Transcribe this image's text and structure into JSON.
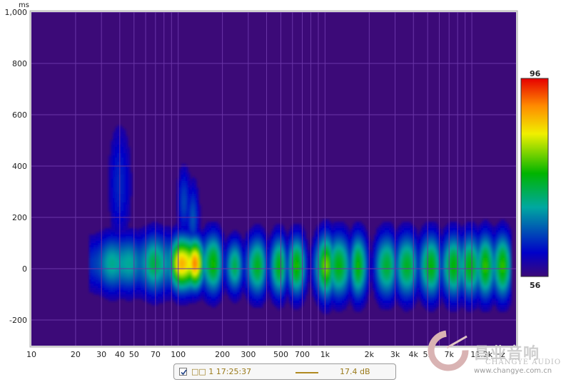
{
  "chart_data": {
    "type": "heatmap",
    "subtype": "spectrogram",
    "title": "",
    "xlabel": "Hz",
    "ylabel": "ms",
    "x_scale": "log",
    "xlim": [
      10,
      20000
    ],
    "ylim": [
      -300,
      1000
    ],
    "x_ticks": [
      {
        "value": 10,
        "label": "10"
      },
      {
        "value": 20,
        "label": "20"
      },
      {
        "value": 30,
        "label": "30"
      },
      {
        "value": 40,
        "label": "40"
      },
      {
        "value": 50,
        "label": "50"
      },
      {
        "value": 70,
        "label": "70"
      },
      {
        "value": 100,
        "label": "100"
      },
      {
        "value": 200,
        "label": "200"
      },
      {
        "value": 300,
        "label": "300"
      },
      {
        "value": 500,
        "label": "500"
      },
      {
        "value": 700,
        "label": "700"
      },
      {
        "value": 1000,
        "label": "1k"
      },
      {
        "value": 2000,
        "label": "2k"
      },
      {
        "value": 3000,
        "label": "3k"
      },
      {
        "value": 4000,
        "label": "4k"
      },
      {
        "value": 5000,
        "label": "5k"
      },
      {
        "value": 7000,
        "label": "7k"
      },
      {
        "value": 11200,
        "label": "11.2k Hz"
      }
    ],
    "y_ticks": [
      {
        "value": 1000,
        "label": "1,000"
      },
      {
        "value": 800,
        "label": "800"
      },
      {
        "value": 600,
        "label": "600"
      },
      {
        "value": 400,
        "label": "400"
      },
      {
        "value": 200,
        "label": "200"
      },
      {
        "value": 0,
        "label": "0"
      },
      {
        "value": -200,
        "label": "-200"
      }
    ],
    "colorbar": {
      "min": 56,
      "max": 96,
      "min_label": "56",
      "max_label": "96"
    },
    "grid": true,
    "series": [
      {
        "name": "□□ 1 17:25:37",
        "value_label": "17.4 dB",
        "color": "#b08a20"
      }
    ],
    "blobs": [
      {
        "f": 40,
        "t": 20,
        "level": 72,
        "bw": 0.16,
        "spread": 75
      },
      {
        "f": 40,
        "t": 330,
        "level": 64,
        "bw": 0.05,
        "spread": 160
      },
      {
        "f": 70,
        "t": 20,
        "level": 74,
        "bw": 0.12,
        "spread": 80
      },
      {
        "f": 110,
        "t": 20,
        "level": 93,
        "bw": 0.07,
        "spread": 70
      },
      {
        "f": 128,
        "t": 20,
        "level": 92,
        "bw": 0.05,
        "spread": 65
      },
      {
        "f": 110,
        "t": 260,
        "level": 66,
        "bw": 0.03,
        "spread": 95
      },
      {
        "f": 125,
        "t": 200,
        "level": 66,
        "bw": 0.03,
        "spread": 95
      },
      {
        "f": 170,
        "t": 20,
        "level": 80,
        "bw": 0.05,
        "spread": 80
      },
      {
        "f": 240,
        "t": 10,
        "level": 76,
        "bw": 0.04,
        "spread": 70
      },
      {
        "f": 340,
        "t": 10,
        "level": 78,
        "bw": 0.05,
        "spread": 80
      },
      {
        "f": 480,
        "t": 10,
        "level": 79,
        "bw": 0.04,
        "spread": 80
      },
      {
        "f": 640,
        "t": 10,
        "level": 82,
        "bw": 0.04,
        "spread": 80
      },
      {
        "f": 1000,
        "t": 10,
        "level": 82,
        "bw": 0.05,
        "spread": 85
      },
      {
        "f": 1250,
        "t": 10,
        "level": 80,
        "bw": 0.05,
        "spread": 85
      },
      {
        "f": 1700,
        "t": 10,
        "level": 80,
        "bw": 0.04,
        "spread": 85
      },
      {
        "f": 2600,
        "t": 10,
        "level": 78,
        "bw": 0.05,
        "spread": 85
      },
      {
        "f": 3600,
        "t": 10,
        "level": 79,
        "bw": 0.05,
        "spread": 85
      },
      {
        "f": 5200,
        "t": 10,
        "level": 80,
        "bw": 0.05,
        "spread": 85
      },
      {
        "f": 7400,
        "t": 10,
        "level": 80,
        "bw": 0.05,
        "spread": 85
      },
      {
        "f": 9800,
        "t": 10,
        "level": 80,
        "bw": 0.05,
        "spread": 85
      },
      {
        "f": 12500,
        "t": 10,
        "level": 79,
        "bw": 0.05,
        "spread": 85
      },
      {
        "f": 16000,
        "t": 10,
        "level": 79,
        "bw": 0.05,
        "spread": 85
      }
    ]
  },
  "legend": {
    "checked": true,
    "name": "□□ 1 17:25:37",
    "value": "17.4 dB"
  },
  "watermark": {
    "brand": "昌业音响",
    "sub": "CHANGYE AUDIO",
    "url": "www.changye.com.cn"
  }
}
